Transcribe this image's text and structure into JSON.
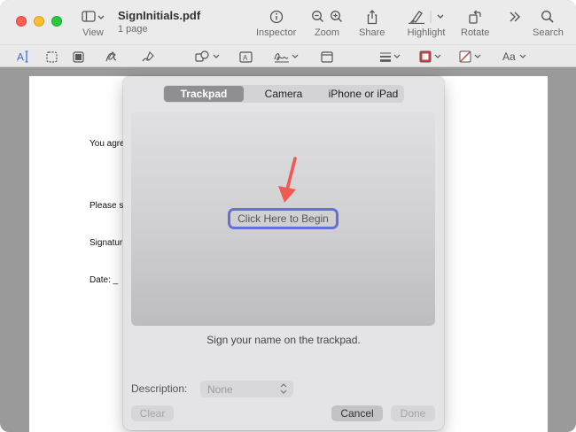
{
  "window": {
    "title": "SignInitials.pdf",
    "subtitle": "1 page"
  },
  "toolbar": {
    "view_label": "View",
    "inspector_label": "Inspector",
    "zoom_label": "Zoom",
    "share_label": "Share",
    "highlight_label": "Highlight",
    "rotate_label": "Rotate",
    "search_label": "Search"
  },
  "markup_bar": {
    "font_button_label": "Aa"
  },
  "document": {
    "lines": [
      "You agre",
      "Please s",
      "Signatur",
      "Date:  _"
    ]
  },
  "signature_sheet": {
    "tabs": [
      "Trackpad",
      "Camera",
      "iPhone or iPad"
    ],
    "active_tab": "Trackpad",
    "begin_label": "Click Here to Begin",
    "hint": "Sign your name on the trackpad.",
    "description_label": "Description:",
    "description_value": "None",
    "clear_label": "Clear",
    "cancel_label": "Cancel",
    "done_label": "Done",
    "highlight_color": "#6470d8",
    "arrow_color": "#ef5b52"
  }
}
